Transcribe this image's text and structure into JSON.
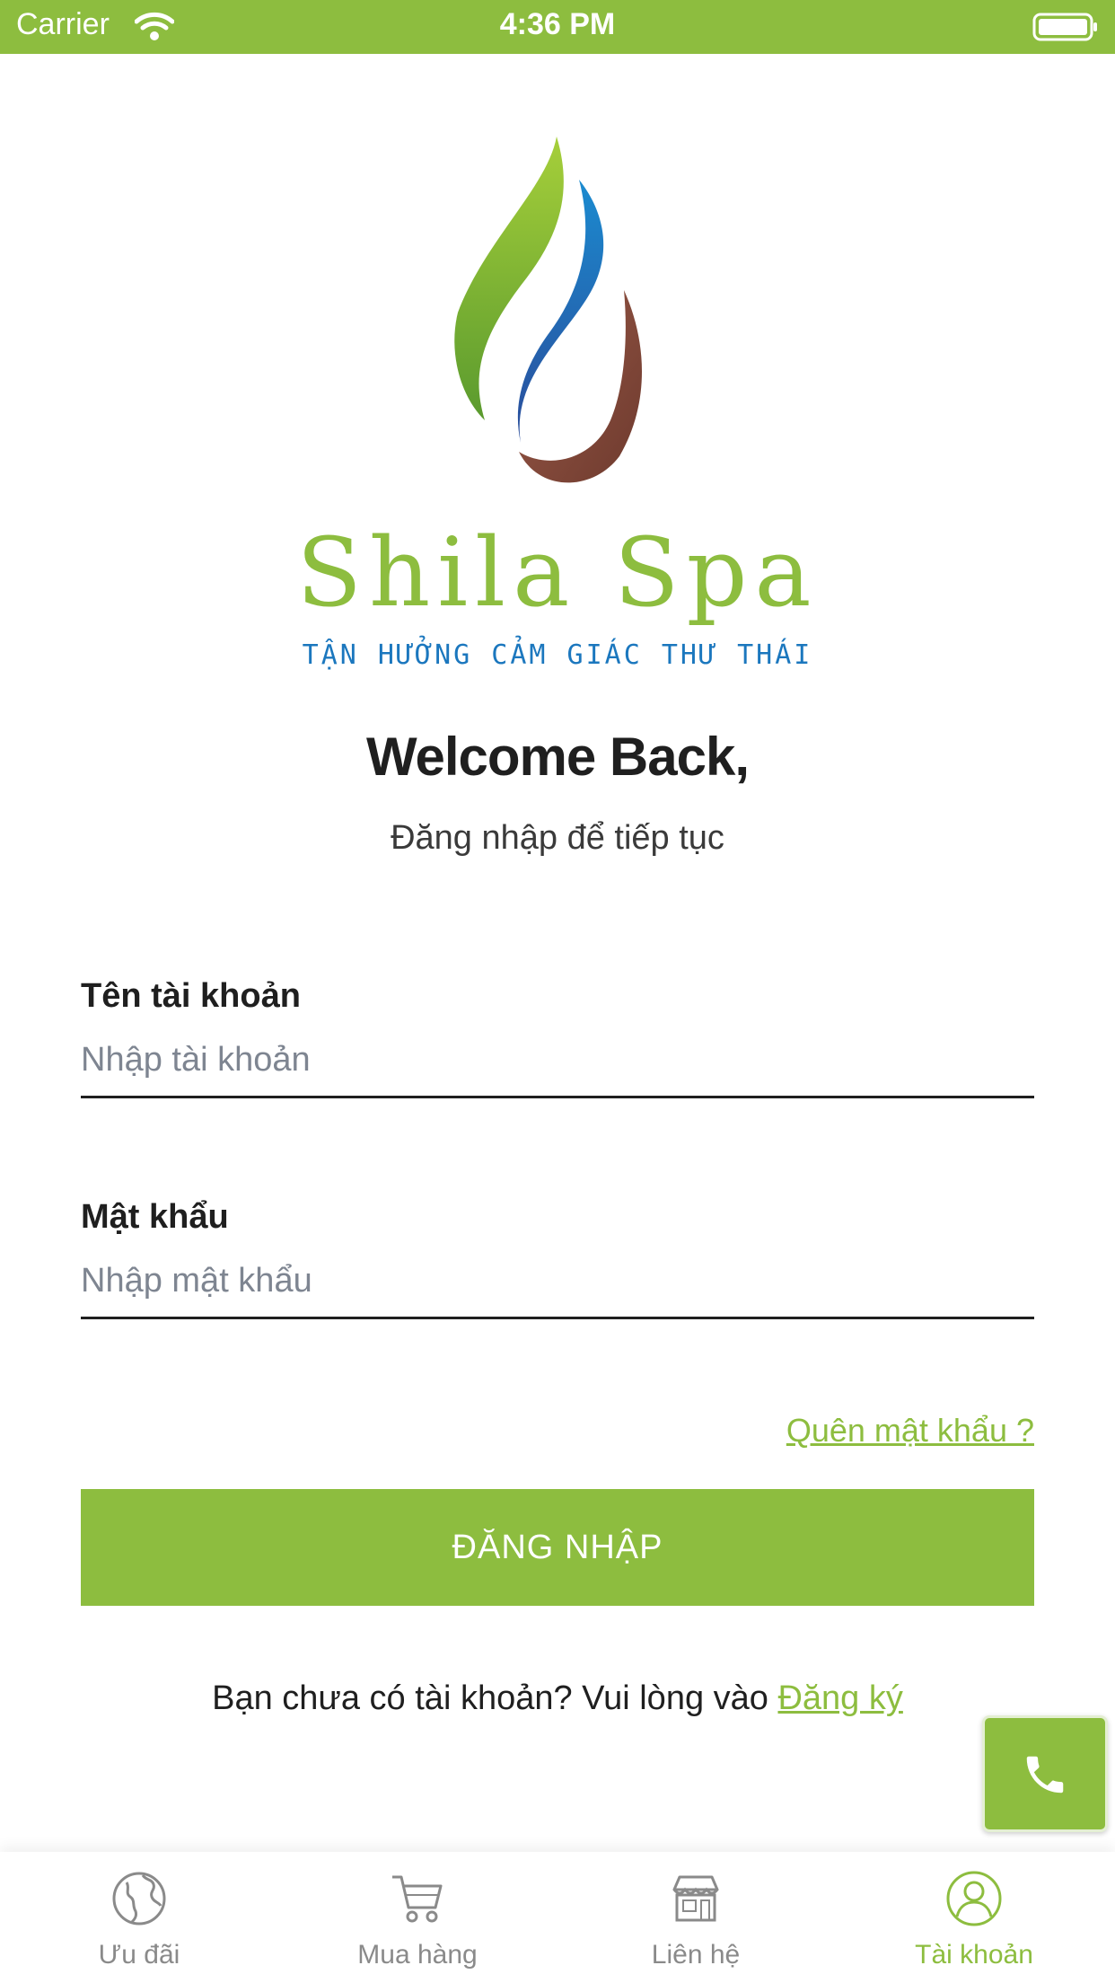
{
  "status_bar": {
    "carrier": "Carrier",
    "time": "4:36 PM"
  },
  "logo": {
    "wordmark": "Shila Spa",
    "tagline": "TẬN HƯỞNG CẢM GIÁC THƯ THÁI"
  },
  "welcome": {
    "title": "Welcome Back,",
    "subtitle": "Đăng nhập để tiếp tục"
  },
  "form": {
    "username_label": "Tên tài khoản",
    "username_placeholder": "Nhập tài khoản",
    "username_value": "",
    "password_label": "Mật khẩu",
    "password_placeholder": "Nhập mật khẩu",
    "password_value": "",
    "forgot_link": "Quên mật khẩu ?",
    "login_button": "ĐĂNG NHẬP"
  },
  "signup": {
    "prompt": "Bạn chưa có tài khoản? Vui lòng vào ",
    "link": "Đăng ký"
  },
  "call_button_icon": "phone-icon",
  "tab_bar": {
    "items": [
      {
        "label": "Ưu đãi",
        "icon": "globe-icon"
      },
      {
        "label": "Mua hàng",
        "icon": "cart-icon"
      },
      {
        "label": "Liên hệ",
        "icon": "store-icon"
      },
      {
        "label": "Tài khoản",
        "icon": "user-icon"
      }
    ],
    "active_index": 3
  },
  "colors": {
    "brand_green": "#8dbd3f",
    "brand_blue": "#1b77be",
    "brand_brown": "#8b4f3f",
    "inactive": "#8a8a8a"
  }
}
